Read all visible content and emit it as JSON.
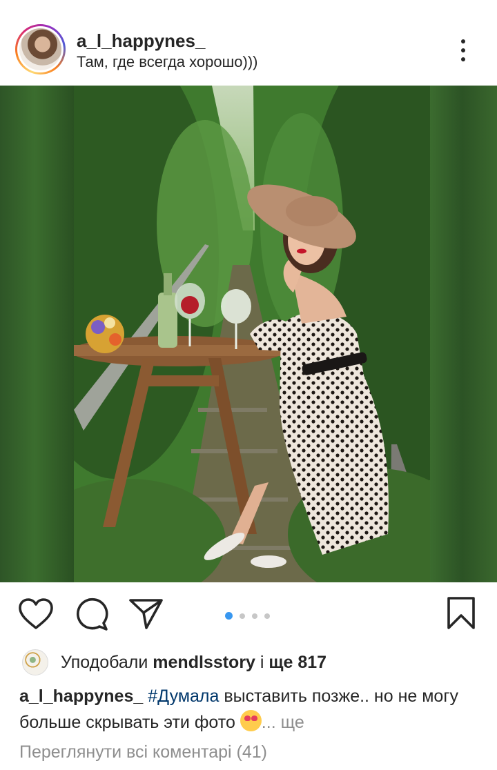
{
  "post": {
    "username": "a_l_happynes_",
    "location": "Там, где всегда хорошо)))",
    "avatar_icon": "profile-photo",
    "more_icon": "more-vertical-icon"
  },
  "photo": {
    "description_icon": "post-photo"
  },
  "actions": {
    "like_icon": "heart-icon",
    "comment_icon": "comment-icon",
    "share_icon": "send-icon",
    "save_icon": "bookmark-icon",
    "carousel_count": 4,
    "carousel_active": 1,
    "accent_color": "#3897f0"
  },
  "likes": {
    "prefix": "Уподобали ",
    "liker": "mendlsstory",
    "middle": " і ",
    "count_text": "ще 817"
  },
  "caption": {
    "username": "a_l_happynes_",
    "hashtag": "#Думала",
    "text": " выставить позже.. но не могу больше скрывать эти фото ",
    "emoji": "😍",
    "more": "... ще"
  },
  "comments": {
    "view_all": "Переглянути всі коментарі (41)"
  }
}
